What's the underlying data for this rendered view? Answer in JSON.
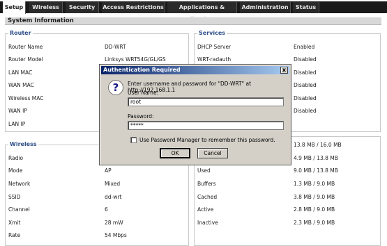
{
  "tabs": [
    {
      "label": "Setup"
    },
    {
      "label": "Wireless"
    },
    {
      "label": "Security"
    },
    {
      "label": "Access Restrictions"
    },
    {
      "label": "Applications & Gaming"
    },
    {
      "label": "Administration"
    },
    {
      "label": "Status"
    }
  ],
  "section_title": "System Information",
  "router": {
    "title": "Router",
    "rows": [
      {
        "label": "Router Name",
        "value": "DD-WRT"
      },
      {
        "label": "Router Model",
        "value": "Linksys WRT54G/GL/GS"
      },
      {
        "label": "LAN MAC",
        "value": ""
      },
      {
        "label": "WAN MAC",
        "value": ""
      },
      {
        "label": "Wireless MAC",
        "value": ""
      },
      {
        "label": "WAN IP",
        "value": ""
      },
      {
        "label": "LAN IP",
        "value": ""
      }
    ]
  },
  "services": {
    "title": "Services",
    "rows": [
      {
        "label": "DHCP Server",
        "value": "Enabled"
      },
      {
        "label": "WRT-radauth",
        "value": "Disabled"
      },
      {
        "label": "",
        "value": "Disabled"
      },
      {
        "label": "",
        "value": "Disabled"
      },
      {
        "label": "",
        "value": "Disabled"
      },
      {
        "label": "",
        "value": "Disabled"
      }
    ]
  },
  "wireless": {
    "title": "Wireless",
    "rows": [
      {
        "label": "Radio",
        "value": ""
      },
      {
        "label": "Mode",
        "value": "AP"
      },
      {
        "label": "Network",
        "value": "Mixed"
      },
      {
        "label": "SSID",
        "value": "dd-wrt"
      },
      {
        "label": "Channel",
        "value": "6"
      },
      {
        "label": "Xmit",
        "value": "28 mW"
      },
      {
        "label": "Rate",
        "value": "54 Mbps"
      }
    ]
  },
  "memory": {
    "rows": [
      {
        "label": "",
        "value": "13.8 MB / 16.0 MB"
      },
      {
        "label": "",
        "value": "4.9 MB / 13.8 MB"
      },
      {
        "label": "Used",
        "value": "9.0 MB / 13.8 MB"
      },
      {
        "label": "Buffers",
        "value": "1.3 MB / 9.0 MB"
      },
      {
        "label": "Cached",
        "value": "3.8 MB / 9.0 MB"
      },
      {
        "label": "Active",
        "value": "2.8 MB / 9.0 MB"
      },
      {
        "label": "Inactive",
        "value": "2.3 MB / 9.0 MB"
      }
    ]
  },
  "dialog": {
    "title": "Authentication Required",
    "close_glyph": "x",
    "icon": "question-icon",
    "icon_glyph": "?",
    "message": "Enter username and password for \"DD-WRT\" at http://192.168.1.1",
    "username_label": "User Name:",
    "username_value": "root",
    "password_label": "Password:",
    "password_value": "*****",
    "remember_label": "Use Password Manager to remember this password.",
    "ok_label": "OK",
    "cancel_label": "Cancel"
  }
}
